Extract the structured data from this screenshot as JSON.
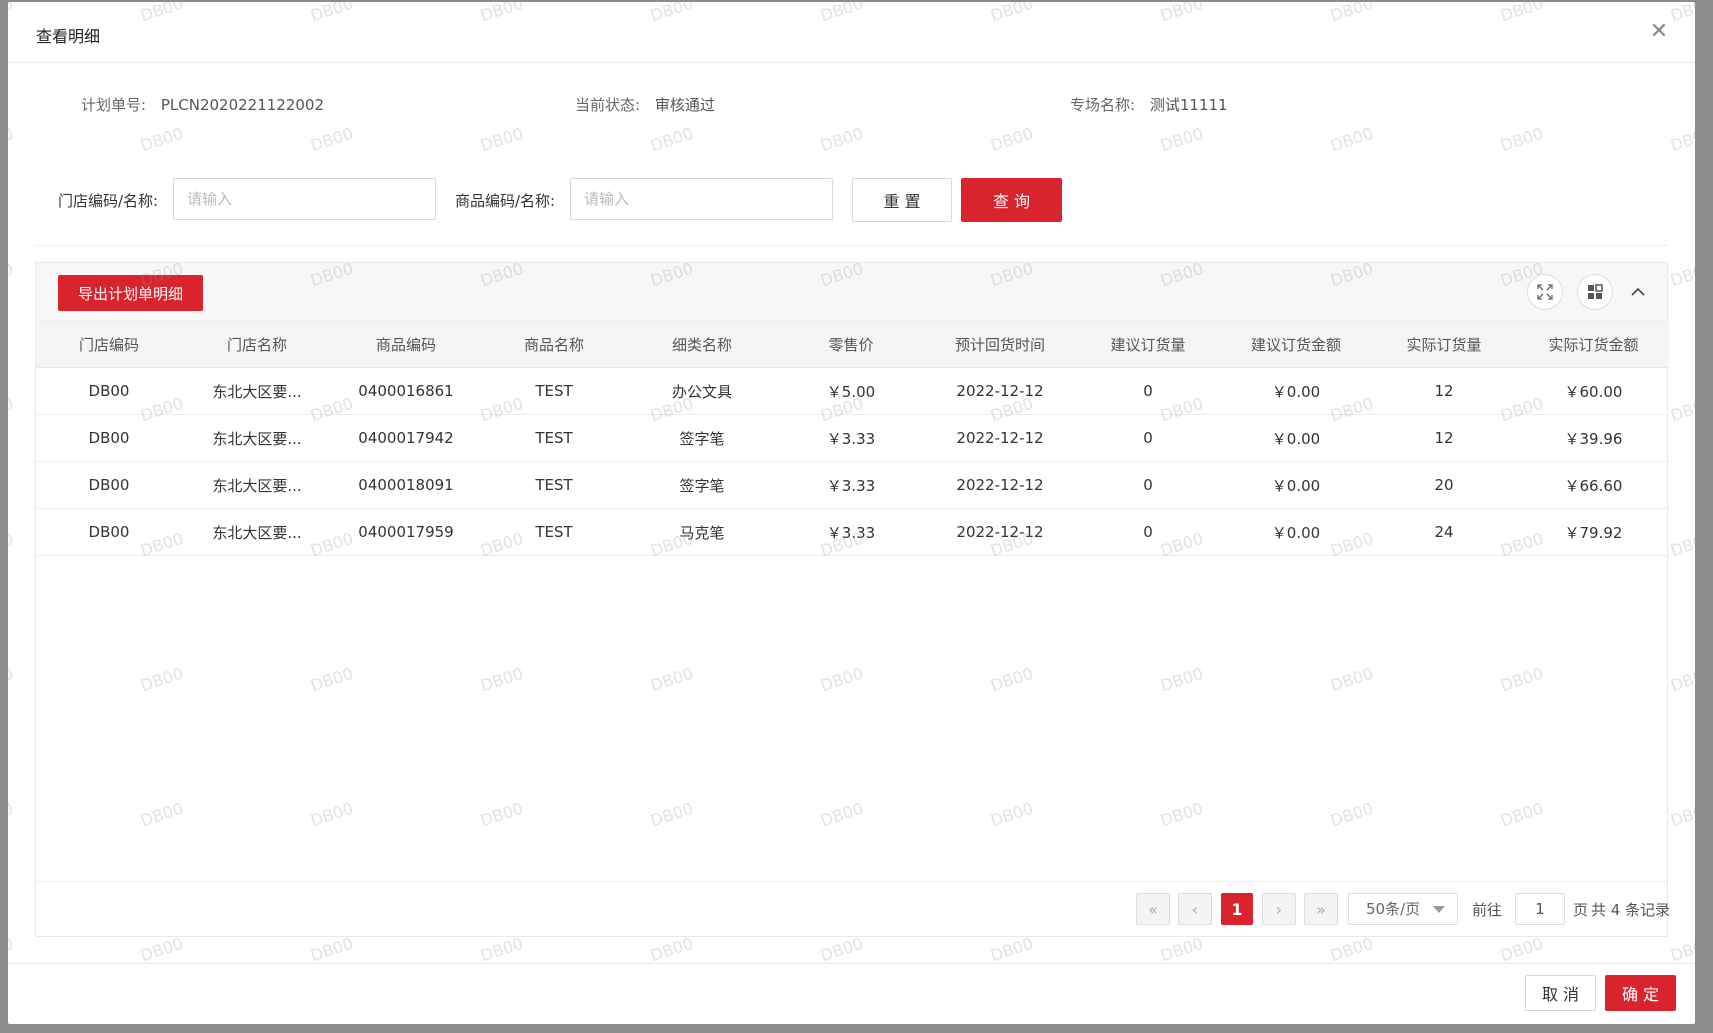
{
  "modal": {
    "title": "查看明细",
    "close_icon": "close-icon"
  },
  "info": {
    "plan_no_label": "计划单号:",
    "plan_no": "PLCN2020221122002",
    "status_label": "当前状态:",
    "status": "审核通过",
    "session_label": "专场名称:",
    "session": "测试11111"
  },
  "filters": {
    "store_label": "门店编码/名称:",
    "store_placeholder": "请输入",
    "store_value": "",
    "product_label": "商品编码/名称:",
    "product_placeholder": "请输入",
    "product_value": "",
    "reset_label": "重 置",
    "query_label": "查 询"
  },
  "toolbar": {
    "export_label": "导出计划单明细",
    "fullscreen_icon": "fullscreen-icon",
    "columns_icon": "grid-icon",
    "collapse_icon": "chevron-up-icon"
  },
  "table": {
    "columns": [
      "门店编码",
      "门店名称",
      "商品编码",
      "商品名称",
      "细类名称",
      "零售价",
      "预计回货时间",
      "建议订货量",
      "建议订货金额",
      "实际订货量",
      "实际订货金额"
    ],
    "rows": [
      [
        "DB00",
        "东北大区要...",
        "0400016861",
        "TEST",
        "办公文具",
        "￥5.00",
        "2022-12-12",
        "0",
        "￥0.00",
        "12",
        "￥60.00"
      ],
      [
        "DB00",
        "东北大区要...",
        "0400017942",
        "TEST",
        "签字笔",
        "￥3.33",
        "2022-12-12",
        "0",
        "￥0.00",
        "12",
        "￥39.96"
      ],
      [
        "DB00",
        "东北大区要...",
        "0400018091",
        "TEST",
        "签字笔",
        "￥3.33",
        "2022-12-12",
        "0",
        "￥0.00",
        "20",
        "￥66.60"
      ],
      [
        "DB00",
        "东北大区要...",
        "0400017959",
        "TEST",
        "马克笔",
        "￥3.33",
        "2022-12-12",
        "0",
        "￥0.00",
        "24",
        "￥79.92"
      ]
    ]
  },
  "pagination": {
    "current_page": "1",
    "page_size": "50条/页",
    "goto_label": "前往",
    "goto_value": "1",
    "page_unit": "页",
    "total_text": "共 4 条记录"
  },
  "footer": {
    "cancel_label": "取 消",
    "confirm_label": "确 定"
  },
  "watermark": "DB00",
  "colors": {
    "primary": "#d9232d",
    "overlay": "#8c8c8c"
  }
}
